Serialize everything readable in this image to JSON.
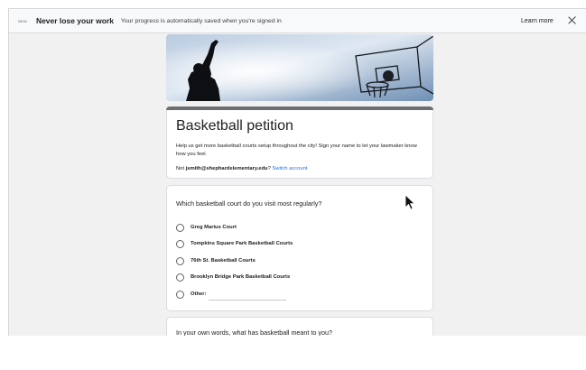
{
  "banner": {
    "badge": "NEW",
    "title": "Never lose your work",
    "message": "Your progress is automatically saved when you're signed in",
    "learn_more": "Learn more"
  },
  "form": {
    "title": "Basketball petition",
    "description": "Help us get more basketball courts setup throughout the city! Sign your name to let your lawmaker know how you feel.",
    "account_prefix": "Not ",
    "account_email": "jsmith@shephardelementary.edu",
    "account_suffix": "?",
    "switch_account": "Switch account"
  },
  "question1": {
    "title": "Which basketball court do you visit most regularly?",
    "options": [
      "Greg Marius Court",
      "Tompkins Square Park Basketball Courts",
      "76th St. Basketball Courts",
      "Brooklyn Bridge Park Basketball Courts",
      "Other:"
    ]
  },
  "question2": {
    "title": "In your own words, what has basketball meant to you?"
  },
  "colors": {
    "accent": "#1a73e8",
    "theme_bar": "#6b6f72",
    "page_bg": "#f1f1f1"
  }
}
